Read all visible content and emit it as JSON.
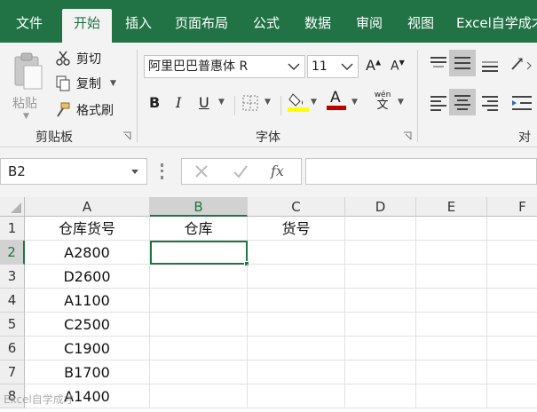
{
  "ribbon_tabs": [
    "文件",
    "开始",
    "插入",
    "页面布局",
    "公式",
    "数据",
    "审阅",
    "视图",
    "Excel自学成才"
  ],
  "clipboard": {
    "paste_label": "粘贴",
    "cut_label": "剪切",
    "copy_label": "复制",
    "format_painter_label": "格式刷",
    "group_label": "剪贴板"
  },
  "font": {
    "font_name": "阿里巴巴普惠体 R",
    "font_size": "11",
    "grow_label": "A",
    "shrink_label": "A",
    "bold_label": "B",
    "italic_label": "I",
    "underline_label": "U",
    "font_color_label": "A",
    "phonetic_top": "wén",
    "phonetic_bottom": "文",
    "group_label": "字体"
  },
  "alignment": {
    "group_label": "对齐"
  },
  "formula_bar": {
    "name_box": "B2",
    "fx_label": "fx",
    "formula": ""
  },
  "grid": {
    "columns": [
      "A",
      "B",
      "C",
      "D",
      "E",
      "F"
    ],
    "selected_column": "B",
    "rows": [
      "1",
      "2",
      "3",
      "4",
      "5",
      "6",
      "7",
      "8"
    ],
    "selected_row": "2",
    "cells": [
      [
        "仓库货号",
        "仓库",
        "货号",
        "",
        "",
        ""
      ],
      [
        "A2800",
        "",
        "",
        "",
        "",
        ""
      ],
      [
        "D2600",
        "",
        "",
        "",
        "",
        ""
      ],
      [
        "A1100",
        "",
        "",
        "",
        "",
        ""
      ],
      [
        "C2500",
        "",
        "",
        "",
        "",
        ""
      ],
      [
        "C1900",
        "",
        "",
        "",
        "",
        ""
      ],
      [
        "B1700",
        "",
        "",
        "",
        "",
        ""
      ],
      [
        "A1400",
        "",
        "",
        "",
        "",
        ""
      ]
    ]
  },
  "colors": {
    "accent": "#217346",
    "underline_highlight": "#ffff00",
    "font_color": "#c00000"
  },
  "watermark": "Excel自学成才"
}
